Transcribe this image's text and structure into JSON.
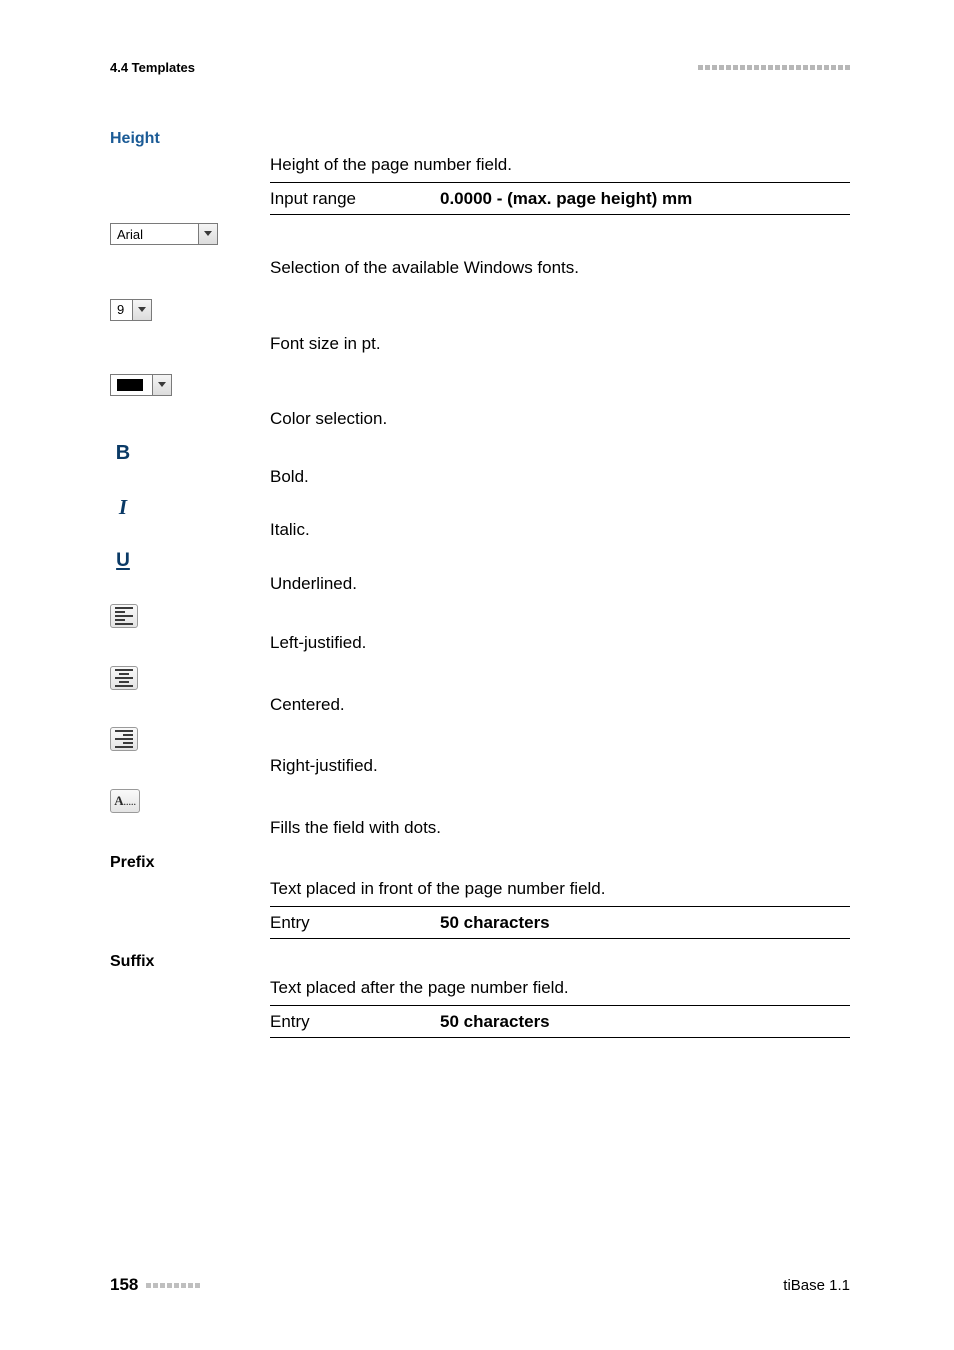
{
  "header": {
    "section": "4.4 Templates"
  },
  "sections": {
    "height": {
      "label": "Height",
      "desc": "Height of the page number field.",
      "spec_key": "Input range",
      "spec_val": "0.0000 - (max. page height) mm"
    },
    "font_select": {
      "value": "Arial",
      "desc": "Selection of the available Windows fonts."
    },
    "size_select": {
      "value": "9",
      "desc": "Font size in pt."
    },
    "color_select": {
      "desc": "Color selection.",
      "swatch": "#000000"
    },
    "bold": {
      "desc": "Bold."
    },
    "italic": {
      "desc": "Italic."
    },
    "underline": {
      "desc": "Underlined."
    },
    "align_left": {
      "desc": "Left-justified."
    },
    "align_center": {
      "desc": "Centered."
    },
    "align_right": {
      "desc": "Right-justified."
    },
    "fill_dots": {
      "desc": "Fills the field with dots."
    },
    "prefix": {
      "label": "Prefix",
      "desc": "Text placed in front of the page number field.",
      "spec_key": "Entry",
      "spec_val": "50 characters"
    },
    "suffix": {
      "label": "Suffix",
      "desc": "Text placed after the page number field.",
      "spec_key": "Entry",
      "spec_val": "50 characters"
    }
  },
  "footer": {
    "page": "158",
    "doc": "tiBase 1.1"
  }
}
